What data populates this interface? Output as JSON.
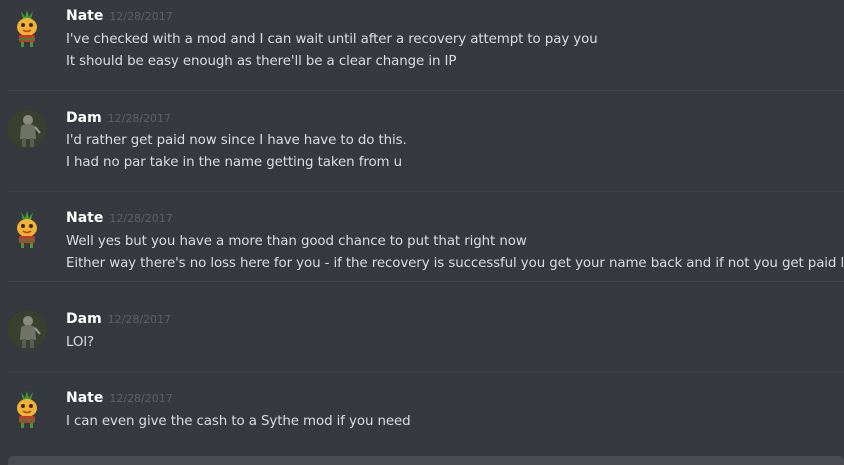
{
  "messages": [
    {
      "author": "Nate",
      "timestamp": "12/28/2017",
      "avatar_icon": "pineapple-avatar-icon",
      "lines": [
        "I've checked with a mod and I can wait until after a recovery attempt to pay you",
        "It should be easy enough as there'll be a clear change in IP"
      ]
    },
    {
      "author": "Dam",
      "timestamp": "12/28/2017",
      "avatar_icon": "character-avatar-icon",
      "lines": [
        "I'd rather get paid now since I have have to do this.",
        "I had no par take in the name getting taken from u"
      ]
    },
    {
      "author": "Nate",
      "timestamp": "12/28/2017",
      "avatar_icon": "pineapple-avatar-icon",
      "lines": [
        "Well yes but you have a more than good chance to put that right now",
        "Either way there's no loss here for you - if the recovery is successful you get your name back and if not you get paid lol"
      ]
    },
    {
      "author": "Dam",
      "timestamp": "12/28/2017",
      "avatar_icon": "character-avatar-icon",
      "lines": [
        "LOl?"
      ]
    },
    {
      "author": "Nate",
      "timestamp": "12/28/2017",
      "avatar_icon": "pineapple-avatar-icon",
      "lines": [
        "I can even give the cash to a Sythe mod if you need"
      ]
    }
  ],
  "composer": {
    "value": ""
  },
  "colors": {
    "background": "#36393f",
    "username": "#ffffff",
    "timestamp": "#5d6067",
    "message_text": "#dcddde",
    "divider": "#3f4248",
    "composer": "#484c52"
  }
}
